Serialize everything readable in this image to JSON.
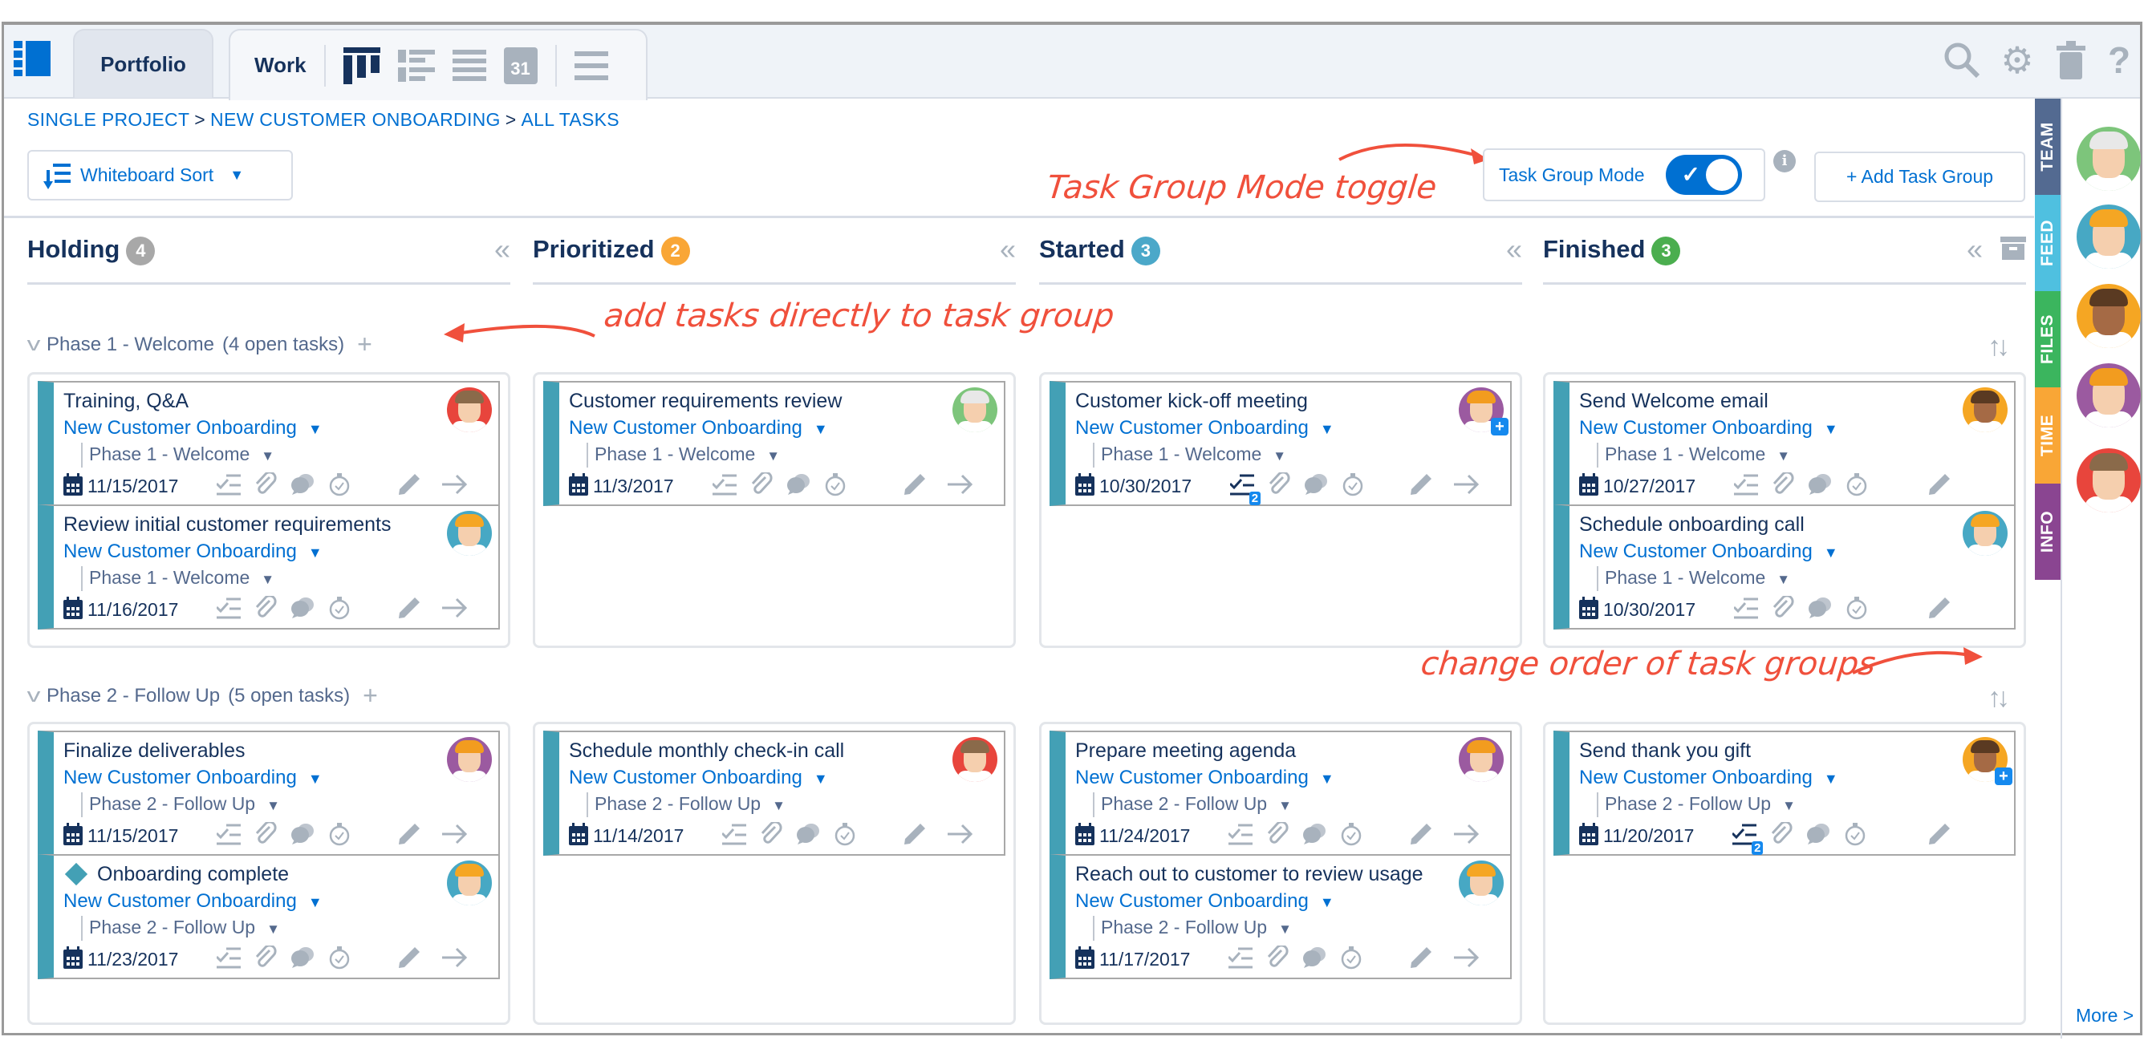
{
  "tabs": {
    "portfolio": "Portfolio",
    "work": "Work",
    "calendar_day": "31"
  },
  "breadcrumb": [
    "SINGLE PROJECT",
    "NEW CUSTOMER ONBOARDING",
    "ALL TASKS"
  ],
  "breadcrumb_sep": ">",
  "toolbar": {
    "sort_label": "Whiteboard Sort",
    "task_group_mode_label": "Task Group Mode",
    "task_group_mode_on": true,
    "add_task_group_label": "+ Add Task Group"
  },
  "annotations": {
    "toggle": "Task Group Mode toggle",
    "add_tasks": "add tasks directly to task group",
    "reorder": "change order of task groups"
  },
  "colors": {
    "accent": "#0070d2",
    "card_stripe": "#43a0b5",
    "annotation": "#f0503c"
  },
  "columns": [
    {
      "title": "Holding",
      "count": "4",
      "badge_color": "#a8a8a8"
    },
    {
      "title": "Prioritized",
      "count": "2",
      "badge_color": "#f9a636"
    },
    {
      "title": "Started",
      "count": "3",
      "badge_color": "#4ba8c9"
    },
    {
      "title": "Finished",
      "count": "3",
      "badge_color": "#4bae4f",
      "archive": true
    }
  ],
  "groups": [
    {
      "name": "Phase 1 - Welcome",
      "open": "(4 open tasks)",
      "columns": [
        [
          {
            "title": "Training, Q&A",
            "project": "New Customer Onboarding",
            "phase": "Phase 1 - Welcome",
            "date": "11/15/2017",
            "avatar": "red"
          },
          {
            "title": "Review initial customer requirements",
            "project": "New Customer Onboarding",
            "phase": "Phase 1 - Welcome",
            "date": "11/16/2017",
            "avatar": "teal"
          }
        ],
        [
          {
            "title": "Customer requirements review",
            "project": "New Customer Onboarding",
            "phase": "Phase 1 - Welcome",
            "date": "11/3/2017",
            "avatar": "green"
          }
        ],
        [
          {
            "title": "Customer kick-off meeting",
            "project": "New Customer Onboarding",
            "phase": "Phase 1 - Welcome",
            "date": "10/30/2017",
            "avatar": "purple",
            "avatar_plus": true,
            "checklist_count": "2"
          }
        ],
        [
          {
            "title": "Send Welcome email",
            "project": "New Customer Onboarding",
            "phase": "Phase 1 - Welcome",
            "date": "10/27/2017",
            "avatar": "orange",
            "done": true
          },
          {
            "title": "Schedule onboarding call",
            "project": "New Customer Onboarding",
            "phase": "Phase 1 - Welcome",
            "date": "10/30/2017",
            "avatar": "teal",
            "done": true
          }
        ]
      ]
    },
    {
      "name": "Phase 2 - Follow Up",
      "open": "(5 open tasks)",
      "columns": [
        [
          {
            "title": "Finalize deliverables",
            "project": "New Customer Onboarding",
            "phase": "Phase 2 - Follow Up",
            "date": "11/15/2017",
            "avatar": "purple"
          },
          {
            "title": "Onboarding complete",
            "project": "New Customer Onboarding",
            "phase": "Phase 2 - Follow Up",
            "date": "11/23/2017",
            "avatar": "teal",
            "milestone": true
          }
        ],
        [
          {
            "title": "Schedule monthly check-in call",
            "project": "New Customer Onboarding",
            "phase": "Phase 2 - Follow Up",
            "date": "11/14/2017",
            "avatar": "red"
          }
        ],
        [
          {
            "title": "Prepare meeting agenda",
            "project": "New Customer Onboarding",
            "phase": "Phase 2 - Follow Up",
            "date": "11/24/2017",
            "avatar": "purple"
          },
          {
            "title": "Reach out to customer to review usage",
            "project": "New Customer Onboarding",
            "phase": "Phase 2 - Follow Up",
            "date": "11/17/2017",
            "avatar": "teal"
          }
        ],
        [
          {
            "title": "Send thank you gift",
            "project": "New Customer Onboarding",
            "phase": "Phase 2 - Follow Up",
            "date": "11/20/2017",
            "avatar": "orange",
            "avatar_plus": true,
            "checklist_count": "2",
            "done": true
          }
        ]
      ]
    }
  ],
  "side_tabs": [
    {
      "label": "TEAM",
      "color": "#536a91"
    },
    {
      "label": "FEED",
      "color": "#4fc0e0"
    },
    {
      "label": "FILES",
      "color": "#3bb55e"
    },
    {
      "label": "TIME",
      "color": "#f9a636"
    },
    {
      "label": "INFO",
      "color": "#8a4591"
    }
  ],
  "team_avatars": [
    "green",
    "teal",
    "orange",
    "purple",
    "red"
  ],
  "more_label": "More >"
}
